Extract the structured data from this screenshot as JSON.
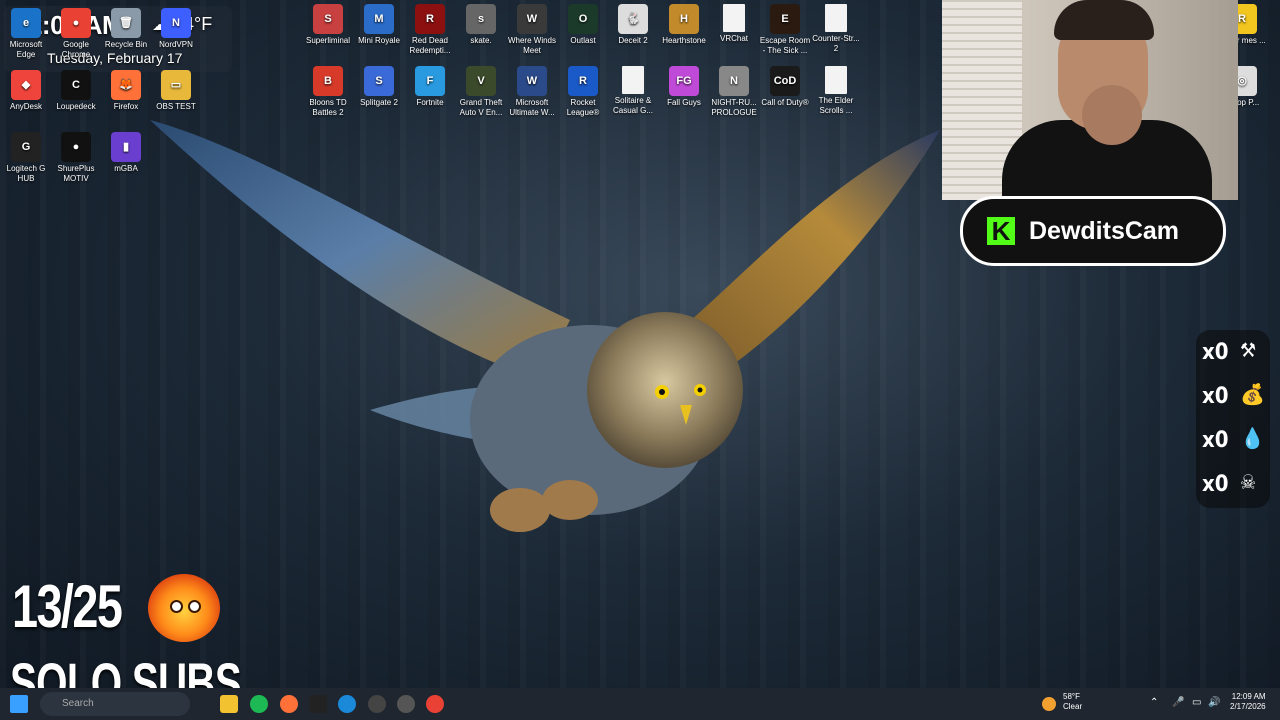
{
  "widgets": {
    "time": "12:09 AM",
    "temperature": "54°F",
    "date": "Tuesday, February 17"
  },
  "desktop_icons": [
    {
      "label": "Microsoft Edge",
      "color": "#1a73c8",
      "glyph": "e"
    },
    {
      "label": "Google Chrome",
      "color": "#e94235",
      "glyph": "●"
    },
    {
      "label": "Recycle Bin",
      "color": "#8a9aa8",
      "glyph": "🗑"
    },
    {
      "label": "NordVPN",
      "color": "#3e5fff",
      "glyph": "N"
    },
    {
      "label": "AnyDesk",
      "color": "#ef443b",
      "glyph": "◆"
    },
    {
      "label": "Loupedeck",
      "color": "#111111",
      "glyph": "C"
    },
    {
      "label": "Firefox",
      "color": "#ff7139",
      "glyph": "🦊"
    },
    {
      "label": "OBS TEST",
      "color": "#e8b83a",
      "glyph": "▭"
    },
    {
      "label": "Logitech G HUB",
      "color": "#222222",
      "glyph": "G"
    },
    {
      "label": "ShurePlus MOTIV",
      "color": "#111111",
      "glyph": "●"
    },
    {
      "label": "mGBA",
      "color": "#6a3fd0",
      "glyph": "▮"
    },
    {
      "label": "Superliminal",
      "color": "#c94040",
      "glyph": "S"
    },
    {
      "label": "Mini Royale",
      "color": "#2a6cc8",
      "glyph": "M"
    },
    {
      "label": "Red Dead Redempti...",
      "color": "#8c1010",
      "glyph": "R"
    },
    {
      "label": "skate.",
      "color": "#666666",
      "glyph": "s"
    },
    {
      "label": "Where Winds Meet",
      "color": "#3a3a3a",
      "glyph": "W"
    },
    {
      "label": "Outlast",
      "color": "#1b3a2a",
      "glyph": "O"
    },
    {
      "label": "Deceit 2",
      "color": "#dddddd",
      "glyph": "🐇"
    },
    {
      "label": "Hearthstone",
      "color": "#c28a2a",
      "glyph": "H"
    },
    {
      "label": "VRChat",
      "color": "#f3f3f3",
      "glyph": ""
    },
    {
      "label": "Escape Room - The Sick ...",
      "color": "#2a1a10",
      "glyph": "E"
    },
    {
      "label": "Counter-Str... 2",
      "color": "#f3f3f3",
      "glyph": ""
    },
    {
      "label": "Bloons TD Battles 2",
      "color": "#d83a2a",
      "glyph": "B"
    },
    {
      "label": "Splitgate 2",
      "color": "#3a6ad8",
      "glyph": "S"
    },
    {
      "label": "Fortnite",
      "color": "#2a9ae0",
      "glyph": "F"
    },
    {
      "label": "Grand Theft Auto V En...",
      "color": "#3a4a2a",
      "glyph": "V"
    },
    {
      "label": "Microsoft Ultimate W...",
      "color": "#2a4a8a",
      "glyph": "W"
    },
    {
      "label": "Rocket League®",
      "color": "#1a5ac8",
      "glyph": "R"
    },
    {
      "label": "Solitaire & Casual G...",
      "color": "#f3f3f3",
      "glyph": ""
    },
    {
      "label": "Fall Guys",
      "color": "#c04ad8",
      "glyph": "FG"
    },
    {
      "label": "NIGHT-RU... PROLOGUE",
      "color": "#888888",
      "glyph": "N"
    },
    {
      "label": "Call of Duty®",
      "color": "#1a1a1a",
      "glyph": "CoD"
    },
    {
      "label": "The Elder Scrolls ...",
      "color": "#f3f3f3",
      "glyph": ""
    },
    {
      "label": "ckstar mes ...",
      "color": "#f2c61f",
      "glyph": "R"
    },
    {
      "label": "ET op P...",
      "color": "#dddddd",
      "glyph": "◎"
    }
  ],
  "overlay": {
    "cam_name": "DewditsCam",
    "cam_brand_glyph": "K",
    "stats": [
      {
        "value": "x0",
        "icon": "⚒"
      },
      {
        "value": "x0",
        "icon": "💰"
      },
      {
        "value": "x0",
        "icon": "💧"
      },
      {
        "value": "x0",
        "icon": "☠"
      }
    ],
    "progress_text": "13/25",
    "progress_current": 13,
    "progress_total": 25,
    "subtitle": "SOLO SUBS"
  },
  "taskbar": {
    "search_placeholder": "Search",
    "weather_temp": "58°F",
    "weather_desc": "Clear",
    "time": "12:09 AM",
    "date": "2/17/2026"
  }
}
